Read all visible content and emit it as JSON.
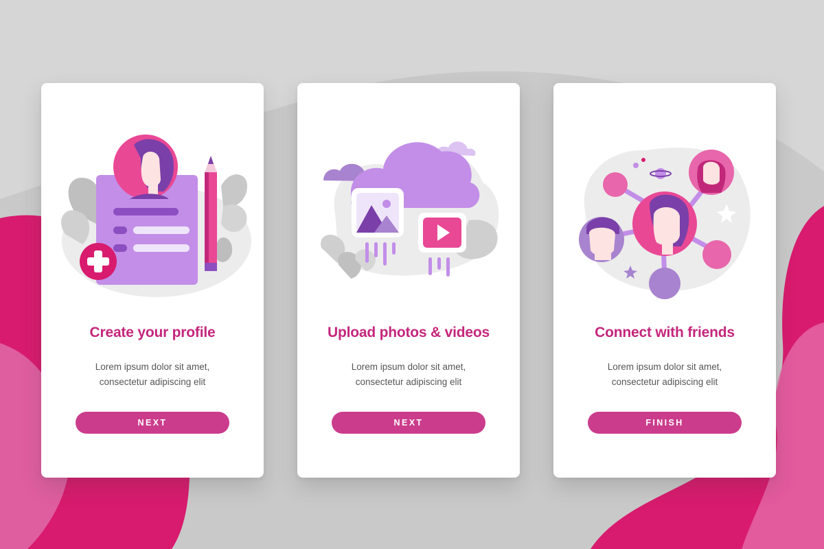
{
  "colors": {
    "accent": "#c4267c",
    "button": "#cb3c8c",
    "purple": "#c28ee8",
    "pink": "#e94895",
    "background": "#d6d6d6"
  },
  "cards": [
    {
      "title": "Create your profile",
      "desc_line1": "Lorem ipsum dolor sit amet,",
      "desc_line2": "consectetur adipiscing elit",
      "button": "NEXT",
      "illustration": "profile-form-illustration"
    },
    {
      "title": "Upload photos & videos",
      "desc_line1": "Lorem ipsum dolor sit amet,",
      "desc_line2": "consectetur adipiscing elit",
      "button": "NEXT",
      "illustration": "cloud-upload-illustration"
    },
    {
      "title": "Connect with friends",
      "desc_line1": "Lorem ipsum dolor sit amet,",
      "desc_line2": "consectetur adipiscing elit",
      "button": "FINISH",
      "illustration": "social-network-illustration"
    }
  ]
}
